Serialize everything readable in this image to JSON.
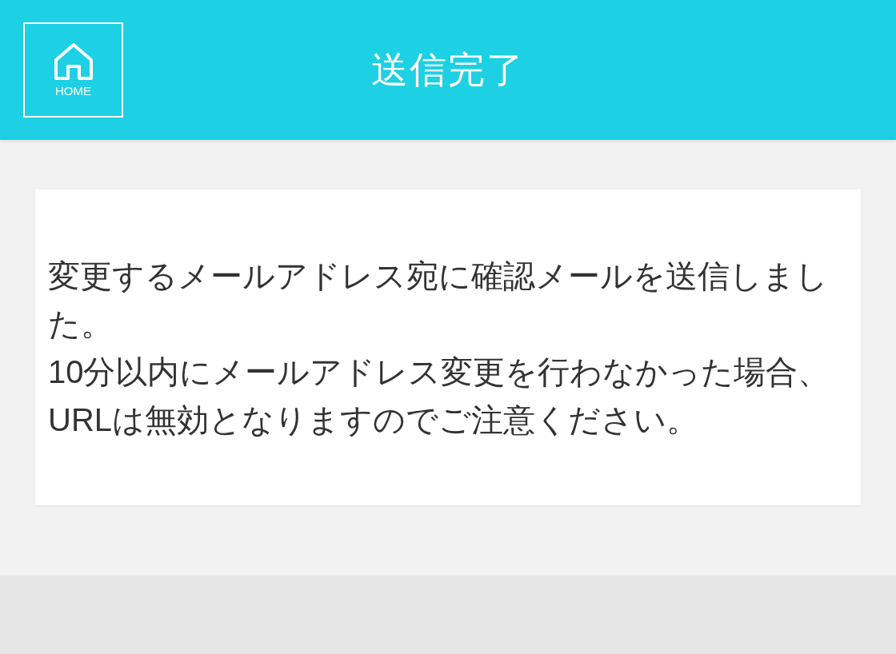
{
  "header": {
    "home_button": {
      "label": "HOME"
    },
    "title": "送信完了"
  },
  "message": {
    "paragraphs": [
      "変更するメールアドレス宛に確認メールを送信しました。",
      "10分以内にメールアドレス変更を行わなかった場合、URLは無効となりますのでご注意ください。"
    ]
  }
}
